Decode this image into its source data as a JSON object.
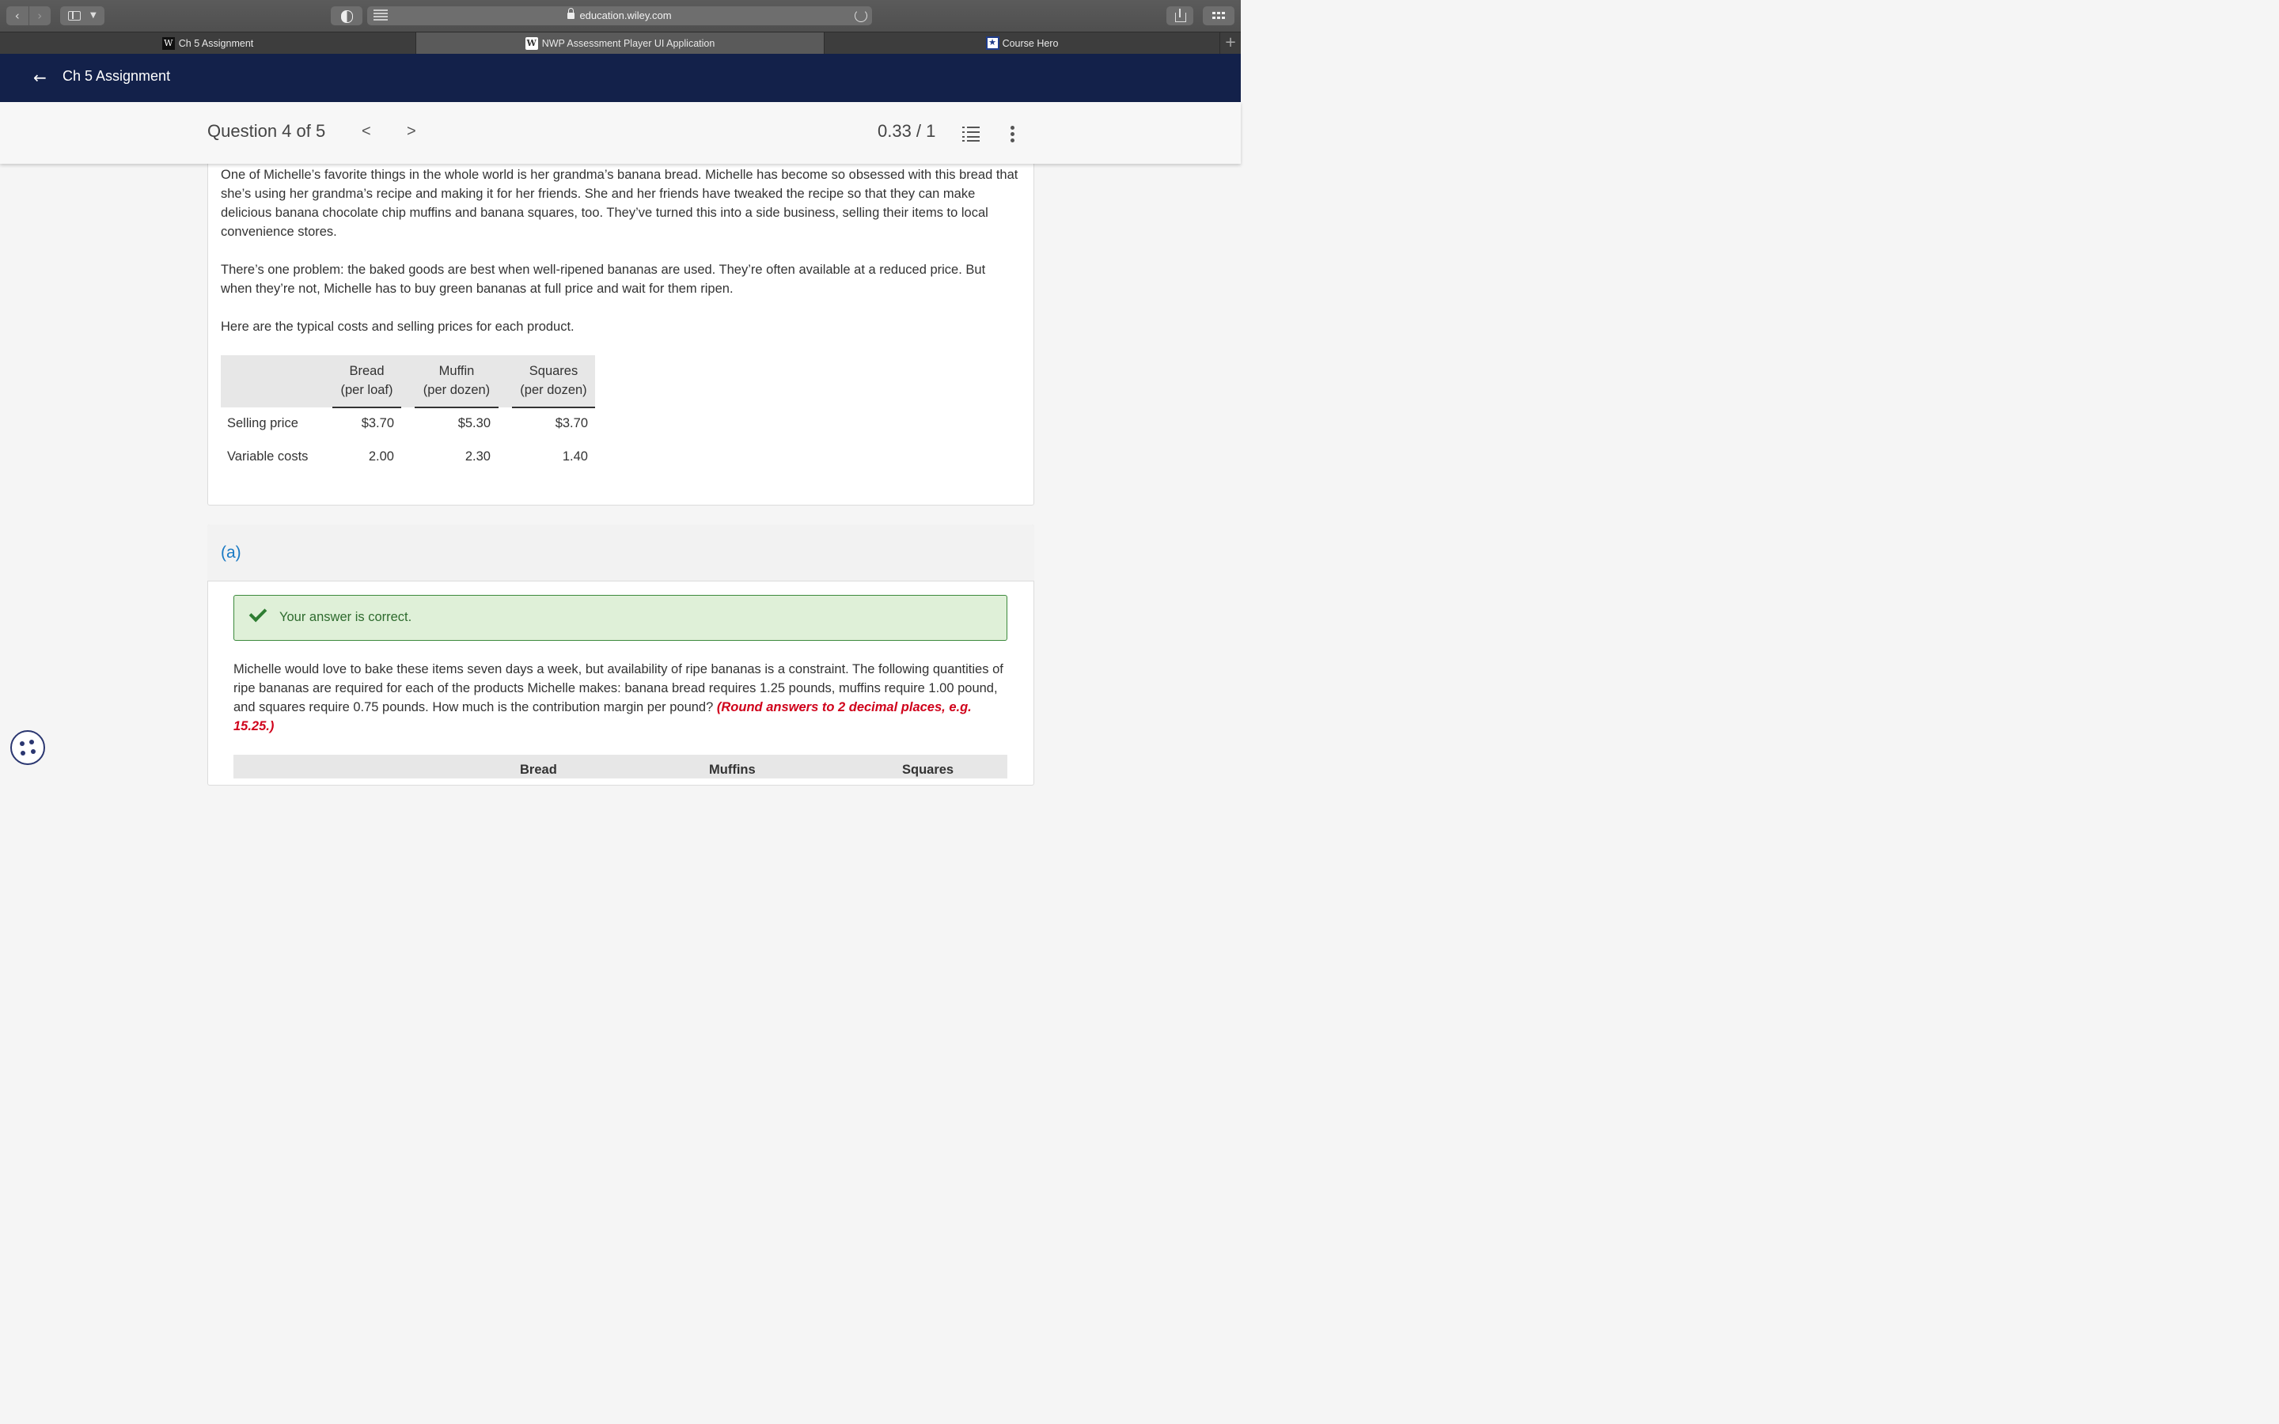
{
  "browser": {
    "url": "education.wiley.com",
    "tabs": [
      {
        "label": "Ch 5 Assignment",
        "favicon": "W"
      },
      {
        "label": "NWP Assessment Player UI Application",
        "favicon": "W"
      },
      {
        "label": "Course Hero",
        "favicon": "★"
      }
    ],
    "new_tab": "+"
  },
  "header": {
    "back": "←",
    "title": "Ch 5 Assignment"
  },
  "question_bar": {
    "counter": "Question 4 of 5",
    "prev": "<",
    "next": ">",
    "score": "0.33 / 1"
  },
  "question": {
    "paragraphs": [
      "One of Michelle’s favorite things in the whole world is her grandma’s banana bread. Michelle has become so obsessed with this bread that she’s using her grandma’s recipe and making it for her friends. She and her friends have tweaked the recipe so that they can make delicious banana chocolate chip muffins and banana squares, too. They’ve turned this into a side business, selling their items to local convenience stores.",
      "There’s one problem: the baked goods are best when well-ripened bananas are used. They’re often available at a reduced price. But when they’re not, Michelle has to buy green bananas at full price and wait for them ripen.",
      "Here are the typical costs and selling prices for each product."
    ],
    "table": {
      "headers": [
        {
          "line1": "Bread",
          "line2": "(per loaf)"
        },
        {
          "line1": "Muffin",
          "line2": "(per dozen)"
        },
        {
          "line1": "Squares",
          "line2": "(per dozen)"
        }
      ],
      "rows": [
        {
          "label": "Selling price",
          "values": [
            "$3.70",
            "$5.30",
            "$3.70"
          ]
        },
        {
          "label": "Variable costs",
          "values": [
            "2.00",
            "2.30",
            "1.40"
          ]
        }
      ]
    }
  },
  "part_a": {
    "label": "(a)",
    "feedback": "Your answer is correct.",
    "prompt": "Michelle would love to bake these items seven days a week, but availability of ripe bananas is a constraint. The following quantities of ripe bananas are required for each of the products Michelle makes: banana bread requires 1.25 pounds, muffins require 1.00 pound, and squares require 0.75 pounds. How much is the contribution margin per pound?",
    "hint": "(Round answers to 2 decimal places, e.g. 15.25.)",
    "answer_headers": [
      "Bread",
      "Muffins",
      "Squares"
    ]
  },
  "colors": {
    "header_bg": "#13214a",
    "link_blue": "#1a7ac4",
    "correct_green": "#2e7d32",
    "hint_red": "#d0021b"
  }
}
